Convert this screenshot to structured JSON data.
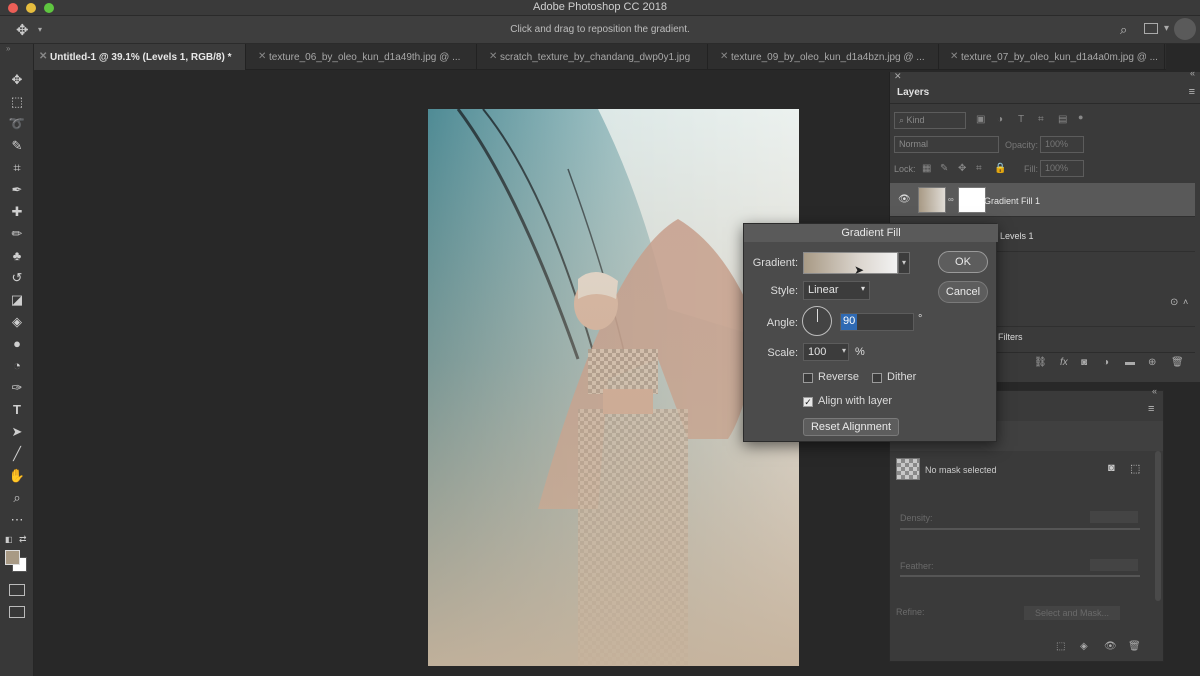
{
  "app": {
    "title": "Adobe Photoshop CC 2018",
    "status_hint": "Click and drag to reposition the gradient."
  },
  "tabs": [
    {
      "label": "Untitled-1 @ 39.1% (Levels 1, RGB/8) *",
      "active": true
    },
    {
      "label": "texture_06_by_oleo_kun_d1a49th.jpg @ ...",
      "active": false
    },
    {
      "label": "scratch_texture_by_chandang_dwp0y1.jpg",
      "active": false
    },
    {
      "label": "texture_09_by_oleo_kun_d1a4bzn.jpg @ ...",
      "active": false
    },
    {
      "label": "texture_07_by_oleo_kun_d1a4a0m.jpg @ ...",
      "active": false
    }
  ],
  "tools": [
    "move-icon",
    "marquee-icon",
    "lasso-icon",
    "quick-select-icon",
    "crop-icon",
    "eyedropper-icon",
    "healing-icon",
    "brush-icon",
    "stamp-icon",
    "history-brush-icon",
    "eraser-icon",
    "paint-bucket-icon",
    "blur-icon",
    "dodge-icon",
    "pen-icon",
    "type-icon",
    "path-select-icon",
    "line-icon",
    "hand-icon",
    "zoom-icon",
    "more-icon"
  ],
  "layers_panel": {
    "title": "Layers",
    "kind_label": "Kind",
    "blend_mode": "Normal",
    "opacity_label": "Opacity:",
    "opacity_value": "100%",
    "lock_label": "Lock:",
    "fill_label": "Fill:",
    "fill_value": "100%",
    "layers": [
      {
        "name": "Gradient Fill 1",
        "selected": true
      },
      {
        "name": "Levels 1",
        "selected": false
      },
      {
        "name": "Filters",
        "selected": false
      }
    ]
  },
  "properties_panel": {
    "mask_text": "No mask selected",
    "density_label": "Density:",
    "feather_label": "Feather:",
    "refine_label": "Refine:",
    "select_mask_button": "Select and Mask..."
  },
  "dialog": {
    "title": "Gradient Fill",
    "gradient_label": "Gradient:",
    "style_label": "Style:",
    "style_value": "Linear",
    "angle_label": "Angle:",
    "angle_value": "90",
    "angle_unit": "°",
    "scale_label": "Scale:",
    "scale_value": "100",
    "scale_unit": "%",
    "reverse_label": "Reverse",
    "reverse_checked": false,
    "dither_label": "Dither",
    "dither_checked": false,
    "align_label": "Align with layer",
    "align_checked": true,
    "reset_button": "Reset Alignment",
    "ok_button": "OK",
    "cancel_button": "Cancel"
  },
  "colors": {
    "foreground": "#a89a85",
    "background": "#ffffff",
    "accent": "#2f6ab3"
  }
}
